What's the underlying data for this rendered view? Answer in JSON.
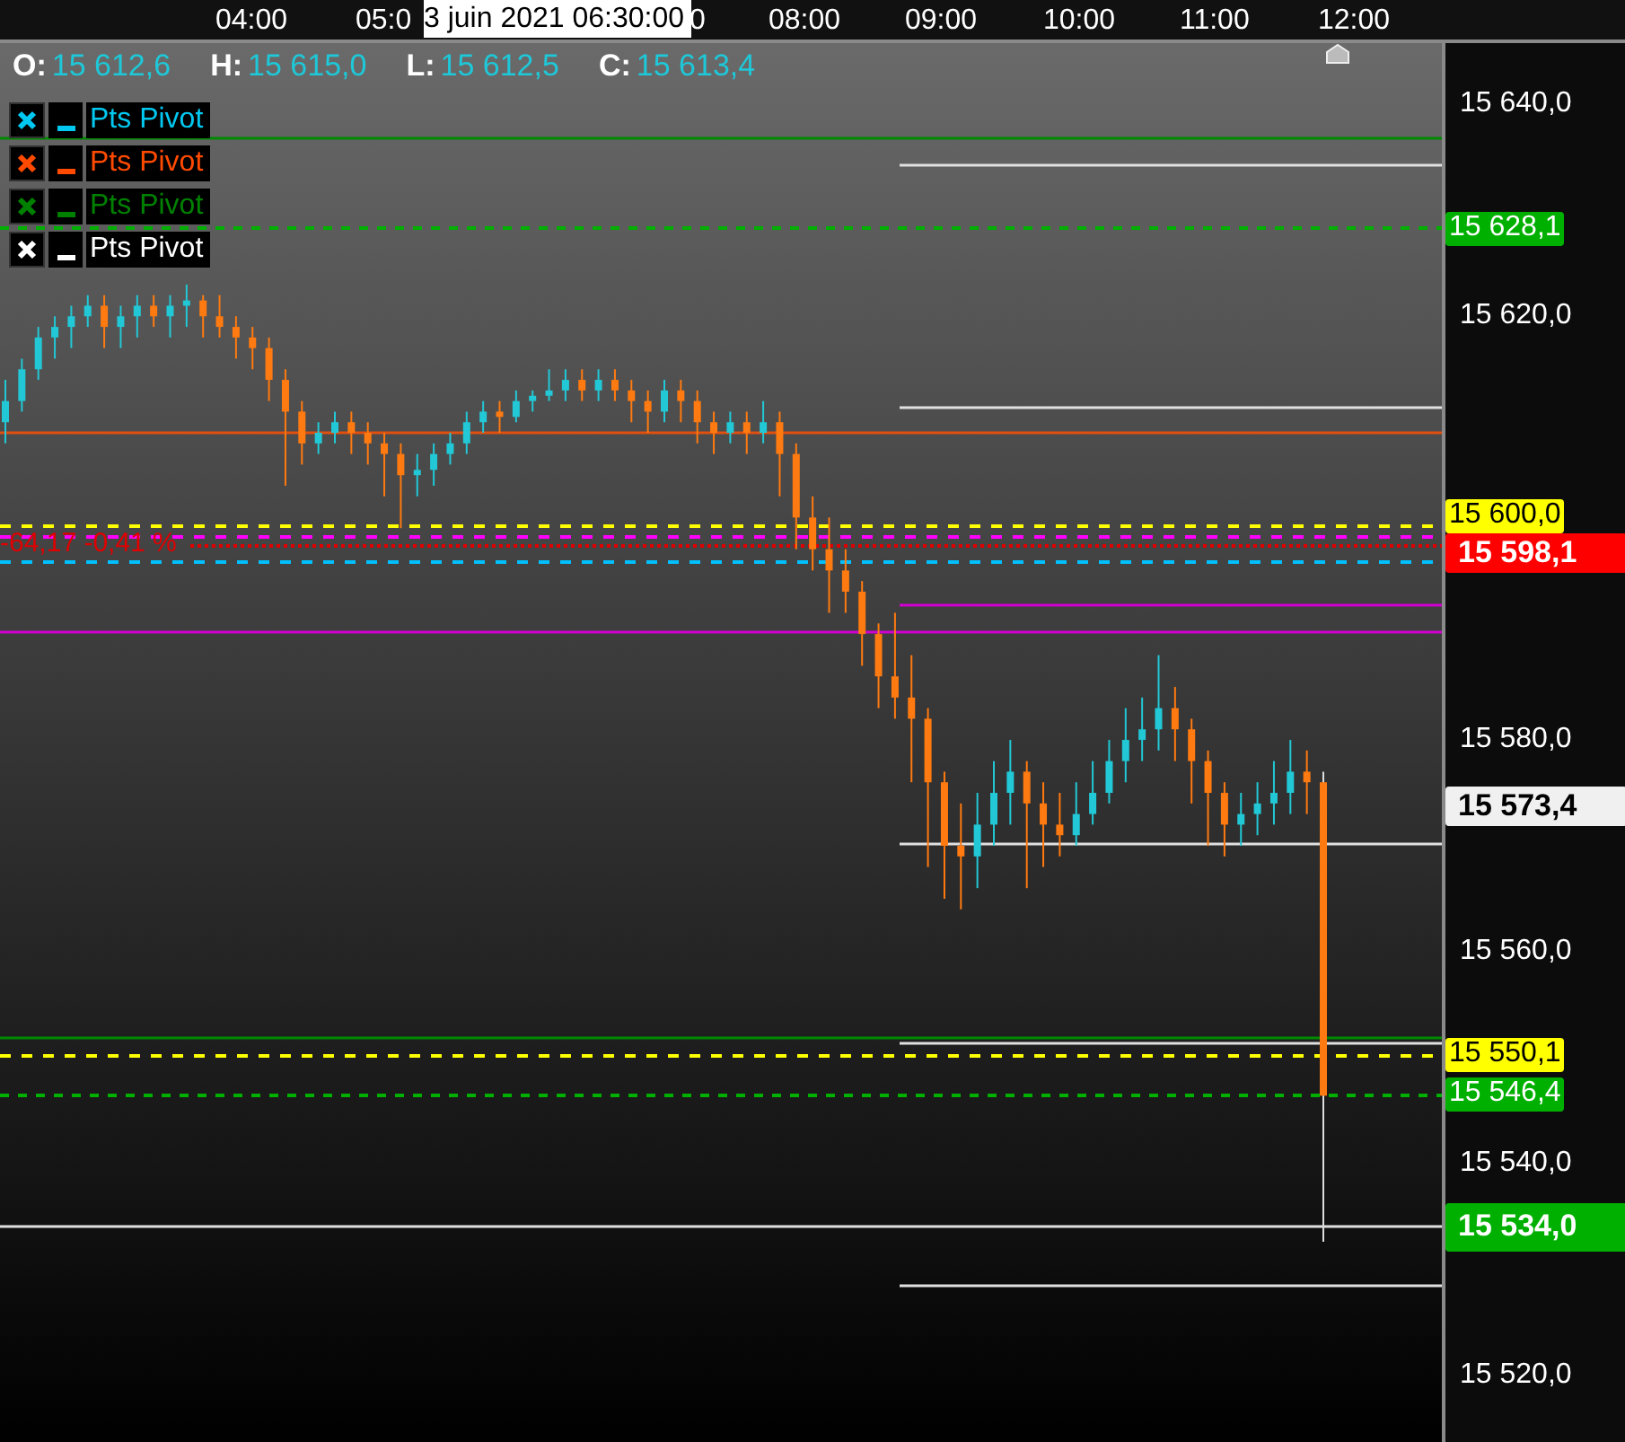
{
  "time_axis": [
    "04:00",
    "05:0",
    "0",
    "08:00",
    "09:00",
    "10:00",
    "11:00",
    "12:00"
  ],
  "crosshair_time": "3 juin 2021 06:30:00",
  "ohlc": [
    {
      "label": "O:",
      "value": "15 612,6"
    },
    {
      "label": "H:",
      "value": "15 615,0"
    },
    {
      "label": "L:",
      "value": "15 612,5"
    },
    {
      "label": "C:",
      "value": "15 613,4"
    }
  ],
  "indicators": [
    {
      "name": "Pts Pivot",
      "color": "#00c8f0"
    },
    {
      "name": "Pts Pivot",
      "color": "#ff4a00"
    },
    {
      "name": "Pts Pivot",
      "color": "#008000"
    },
    {
      "name": "Pts Pivot",
      "color": "#ffffff"
    }
  ],
  "change_readout": "-64,17 -0,41 %",
  "price_chart": {
    "chart_data": {
      "type": "candlestick",
      "ylim": [
        15513.7,
        15645.8
      ],
      "yticks": [
        {
          "value": 15640,
          "label": "15 640,0"
        },
        {
          "value": 15620,
          "label": "15 620,0"
        },
        {
          "value": 15580,
          "label": "15 580,0"
        },
        {
          "value": 15560,
          "label": "15 560,0"
        },
        {
          "value": 15540,
          "label": "15 540,0"
        },
        {
          "value": 15520,
          "label": "15 520,0"
        }
      ],
      "categories": [
        null,
        null,
        null,
        null,
        null,
        null,
        null,
        null,
        null,
        null,
        null,
        null,
        null,
        null,
        null,
        null,
        null,
        null,
        null,
        null,
        null,
        null,
        null,
        null,
        null,
        null,
        null,
        null,
        null,
        null,
        null,
        null,
        null,
        null,
        null,
        null,
        null,
        null,
        null,
        null,
        null,
        null,
        null,
        null,
        null,
        null,
        null,
        null,
        null,
        null,
        null,
        null,
        null,
        null,
        null,
        null,
        null,
        null,
        null,
        null,
        null,
        null,
        null,
        null,
        null,
        null,
        null,
        null,
        null,
        null,
        null,
        null,
        null,
        null,
        null,
        null,
        null,
        null,
        null,
        null,
        null
      ],
      "ohlc": [
        [
          15610,
          15614,
          15608,
          15612
        ],
        [
          15612,
          15616,
          15611,
          15615
        ],
        [
          15615,
          15619,
          15614,
          15618
        ],
        [
          15618,
          15620,
          15616,
          15619
        ],
        [
          15619,
          15621,
          15617,
          15620
        ],
        [
          15620,
          15622,
          15619,
          15621
        ],
        [
          15621,
          15622,
          15617,
          15619
        ],
        [
          15619,
          15621,
          15617,
          15620
        ],
        [
          15620,
          15622,
          15618,
          15621
        ],
        [
          15621,
          15622,
          15619,
          15620
        ],
        [
          15620,
          15622,
          15618,
          15621
        ],
        [
          15621,
          15623,
          15619,
          15621.5
        ],
        [
          15621.5,
          15622,
          15618,
          15620
        ],
        [
          15620,
          15622,
          15618,
          15619
        ],
        [
          15619,
          15620,
          15616,
          15618
        ],
        [
          15618,
          15619,
          15615,
          15617
        ],
        [
          15617,
          15618,
          15612,
          15614
        ],
        [
          15614,
          15615,
          15604,
          15611
        ],
        [
          15611,
          15612,
          15606,
          15608
        ],
        [
          15608,
          15610,
          15607,
          15609
        ],
        [
          15609,
          15611,
          15608,
          15610
        ],
        [
          15610,
          15611,
          15607,
          15609
        ],
        [
          15609,
          15610,
          15606,
          15608
        ],
        [
          15608,
          15609,
          15603,
          15607
        ],
        [
          15607,
          15608,
          15600,
          15605
        ],
        [
          15605,
          15607,
          15603,
          15605.5
        ],
        [
          15605.5,
          15608,
          15604,
          15607
        ],
        [
          15607,
          15609,
          15606,
          15608
        ],
        [
          15608,
          15611,
          15607,
          15610
        ],
        [
          15610,
          15612,
          15609,
          15611
        ],
        [
          15611,
          15612,
          15609,
          15610.5
        ],
        [
          15610.5,
          15613,
          15610,
          15612
        ],
        [
          15612,
          15613,
          15611,
          15612.5
        ],
        [
          15612.5,
          15615,
          15612,
          15613
        ],
        [
          15613,
          15615,
          15612,
          15614
        ],
        [
          15614,
          15615,
          15612,
          15613
        ],
        [
          15613,
          15615,
          15612,
          15614
        ],
        [
          15614,
          15615,
          15612,
          15613
        ],
        [
          15613,
          15614,
          15610,
          15612
        ],
        [
          15612,
          15613,
          15609,
          15611
        ],
        [
          15611,
          15614,
          15610,
          15613
        ],
        [
          15613,
          15614,
          15610,
          15612
        ],
        [
          15612,
          15613,
          15608,
          15610
        ],
        [
          15610,
          15611,
          15607,
          15609
        ],
        [
          15609,
          15611,
          15608,
          15610
        ],
        [
          15610,
          15611,
          15607,
          15609
        ],
        [
          15609,
          15612,
          15608,
          15610
        ],
        [
          15610,
          15611,
          15603,
          15607
        ],
        [
          15607,
          15608,
          15598,
          15601
        ],
        [
          15601,
          15603,
          15596,
          15598
        ],
        [
          15598,
          15601,
          15592,
          15596
        ],
        [
          15596,
          15598,
          15592,
          15594
        ],
        [
          15594,
          15595,
          15587,
          15590
        ],
        [
          15590,
          15591,
          15583,
          15586
        ],
        [
          15586,
          15592,
          15582,
          15584
        ],
        [
          15584,
          15588,
          15576,
          15582
        ],
        [
          15582,
          15583,
          15568,
          15576
        ],
        [
          15576,
          15577,
          15565,
          15570
        ],
        [
          15570,
          15574,
          15564,
          15569
        ],
        [
          15569,
          15575,
          15566,
          15572
        ],
        [
          15572,
          15578,
          15570,
          15575
        ],
        [
          15575,
          15580,
          15572,
          15577
        ],
        [
          15577,
          15578,
          15566,
          15574
        ],
        [
          15574,
          15576,
          15568,
          15572
        ],
        [
          15572,
          15575,
          15569,
          15571
        ],
        [
          15571,
          15576,
          15570,
          15573
        ],
        [
          15573,
          15578,
          15572,
          15575
        ],
        [
          15575,
          15580,
          15574,
          15578
        ],
        [
          15578,
          15583,
          15576,
          15580
        ],
        [
          15580,
          15584,
          15578,
          15581
        ],
        [
          15581,
          15588,
          15579,
          15583
        ],
        [
          15583,
          15585,
          15578,
          15581
        ],
        [
          15581,
          15582,
          15574,
          15578
        ],
        [
          15578,
          15579,
          15570,
          15575
        ],
        [
          15575,
          15576,
          15569,
          15572
        ],
        [
          15572,
          15575,
          15570,
          15573
        ],
        [
          15573,
          15576,
          15571,
          15574
        ],
        [
          15574,
          15578,
          15572,
          15575
        ],
        [
          15575,
          15580,
          15573,
          15577
        ],
        [
          15577,
          15579,
          15573,
          15576
        ],
        [
          15576,
          15577,
          15532.6,
          15546.4
        ]
      ]
    }
  },
  "price_tags": [
    {
      "text": "15 628,1",
      "color": "#00b000"
    },
    {
      "text": "15 600,0",
      "color": "#ffff00"
    },
    {
      "text": "15 598,1",
      "color": "#ff0000"
    },
    {
      "text": "15 573,4",
      "color": "#f0f0f0"
    },
    {
      "text": "15 550,1",
      "color": "#ffff00"
    },
    {
      "text": "15 546,4",
      "color": "#00b000"
    },
    {
      "text": "15 534,0",
      "color": "#00b000"
    }
  ]
}
